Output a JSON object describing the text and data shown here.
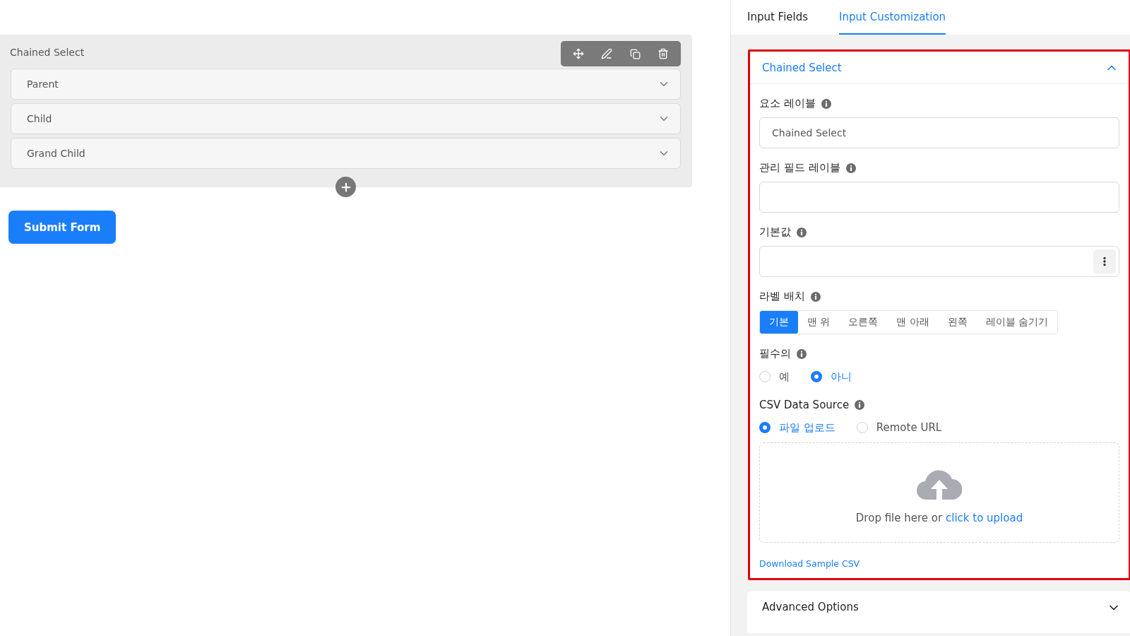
{
  "form_preview": {
    "field_label": "Chained Select",
    "selects": [
      {
        "placeholder": "Parent"
      },
      {
        "placeholder": "Child"
      },
      {
        "placeholder": "Grand Child"
      }
    ],
    "submit_button": "Submit Form"
  },
  "tabs": [
    {
      "label": "Input Fields",
      "selected": false
    },
    {
      "label": "Input Customization",
      "selected": true
    }
  ],
  "settings_panel": {
    "title": "Chained Select",
    "expanded": true,
    "element_label": {
      "label": "요소 레이블",
      "value": "Chained Select"
    },
    "admin_field_label": {
      "label": "관리 필드 레이블"
    },
    "default_value": {
      "label": "기본값"
    },
    "label_placement": {
      "label": "라벨 배치",
      "options": [
        {
          "label": "기본",
          "selected": true
        },
        {
          "label": "맨 위",
          "selected": false
        },
        {
          "label": "오른쪽",
          "selected": false
        },
        {
          "label": "맨 아래",
          "selected": false
        },
        {
          "label": "왼쪽",
          "selected": false
        },
        {
          "label": "레이블 숨기기",
          "selected": false
        }
      ]
    },
    "required": {
      "label": "필수의",
      "options": [
        {
          "label": "예",
          "selected": false
        },
        {
          "label": "아니",
          "selected": true
        }
      ]
    },
    "csv_data_source": {
      "label": "CSV Data Source",
      "options": [
        {
          "label": "파일 업로드",
          "selected": true
        },
        {
          "label": "Remote URL",
          "selected": false
        }
      ],
      "drop_text": "Drop file here or",
      "upload_link": "click to upload",
      "download_link": "Download Sample CSV"
    }
  },
  "advanced_options": {
    "title": "Advanced Options",
    "expanded": false
  }
}
